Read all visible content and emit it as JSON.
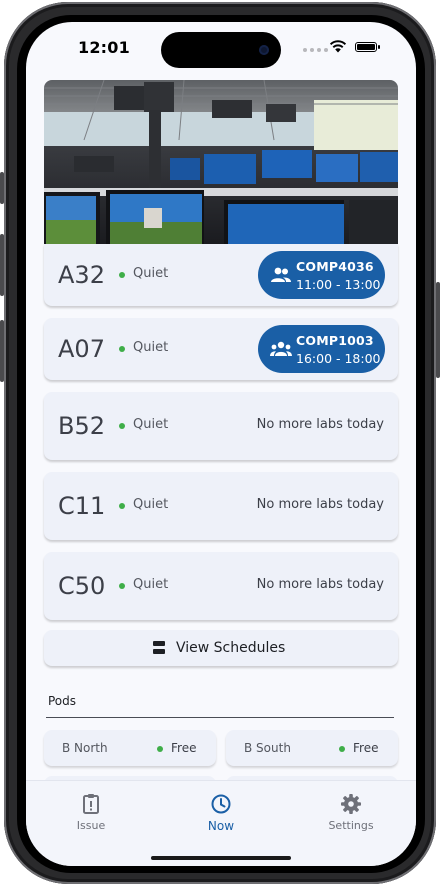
{
  "status_bar": {
    "time": "12:01"
  },
  "labs": [
    {
      "name": "A32",
      "status": "Quiet",
      "next_course": "COMP4036",
      "next_time": "11:00 - 13:00",
      "no_labs_text": ""
    },
    {
      "name": "A07",
      "status": "Quiet",
      "next_course": "COMP1003",
      "next_time": "16:00 - 18:00",
      "no_labs_text": ""
    },
    {
      "name": "B52",
      "status": "Quiet",
      "next_course": "",
      "next_time": "",
      "no_labs_text": "No more labs today"
    },
    {
      "name": "C11",
      "status": "Quiet",
      "next_course": "",
      "next_time": "",
      "no_labs_text": "No more labs today"
    },
    {
      "name": "C50",
      "status": "Quiet",
      "next_course": "",
      "next_time": "",
      "no_labs_text": "No more labs today"
    }
  ],
  "view_schedules": {
    "label": "View Schedules",
    "icon": "schedule-list-icon"
  },
  "pods": {
    "heading": "Pods",
    "items": [
      {
        "name": "B North",
        "status": "Free"
      },
      {
        "name": "B South",
        "status": "Free"
      }
    ]
  },
  "tabs": [
    {
      "label": "Issue",
      "icon": "issue-icon",
      "active": false
    },
    {
      "label": "Now",
      "icon": "clock-icon",
      "active": true
    },
    {
      "label": "Settings",
      "icon": "gear-icon",
      "active": false
    }
  ],
  "colors": {
    "accent": "#1a5fa6",
    "status_quiet": "#3fae49",
    "card_bg": "#eef1f9",
    "screen_bg": "#f8f9fd"
  }
}
